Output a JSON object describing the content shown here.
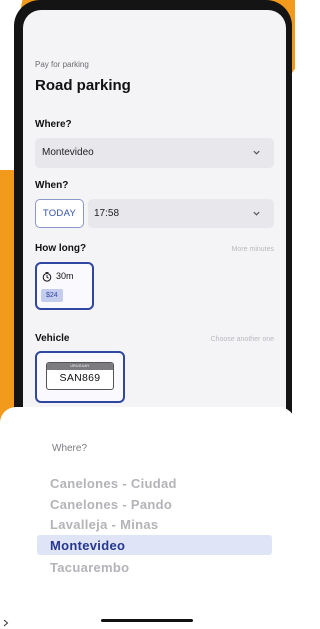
{
  "header": {
    "subtitle": "Pay for parking",
    "title": "Road parking"
  },
  "where": {
    "label": "Where?",
    "value": "Montevideo",
    "icon": "chevron-down-icon"
  },
  "when": {
    "label": "When?",
    "today_label": "TODAY",
    "time": "17:58",
    "icon": "chevron-down-icon"
  },
  "how_long": {
    "label": "How long?",
    "hint": "More minutes",
    "option": {
      "duration": "30m",
      "price": "$24",
      "icon": "clock-icon"
    }
  },
  "vehicle": {
    "label": "Vehicle",
    "hint": "Choose another one",
    "plate_country": "URUGUAY",
    "plate_number": "SAN869"
  },
  "picker": {
    "title": "Where?",
    "options": [
      "Canelones - Ciudad",
      "Canelones - Pando",
      "Lavalleja - Minas",
      "Montevideo",
      "Tacuarembo"
    ],
    "selected_index": 3
  },
  "colors": {
    "accent": "#2f47a0",
    "selected_text": "#26388f",
    "selected_bg": "#dfe4f7",
    "background_orange": "#f29a1c"
  }
}
